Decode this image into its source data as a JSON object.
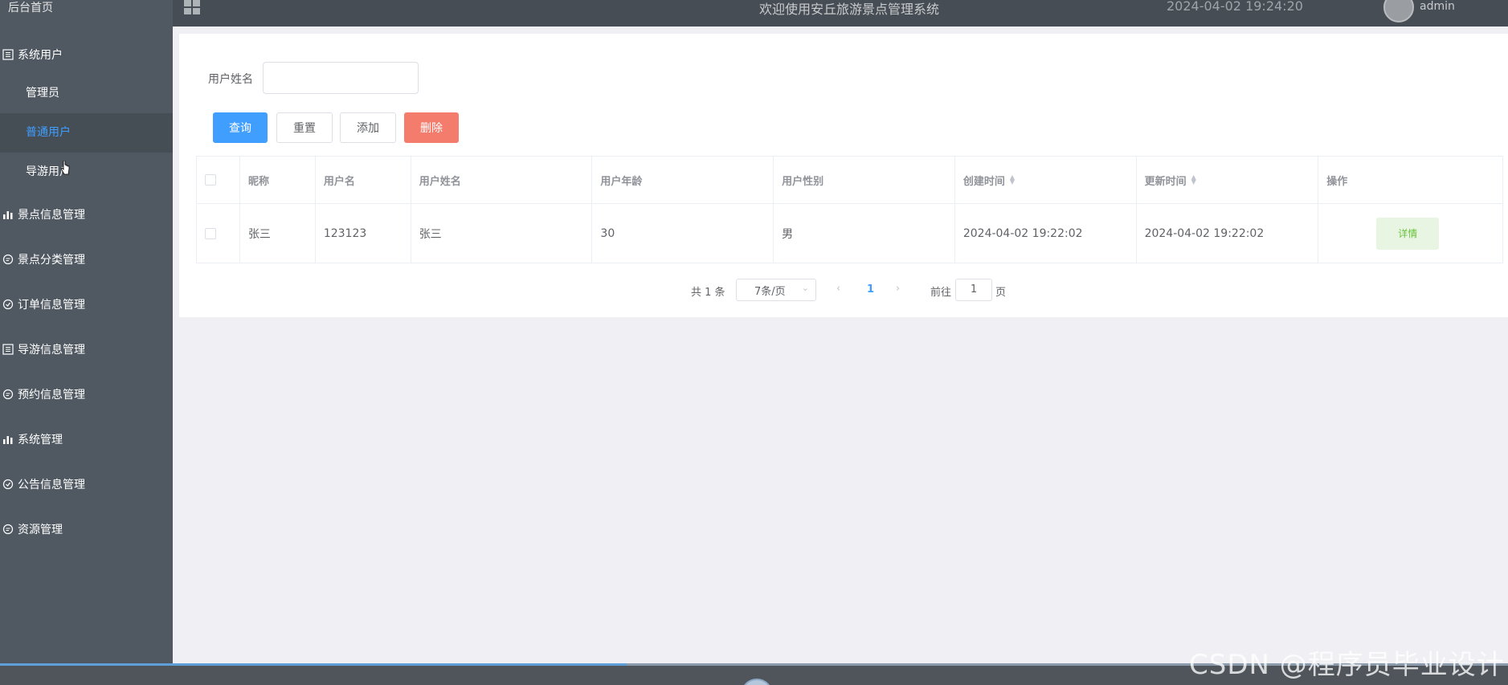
{
  "sidebar": {
    "home": "后台首页",
    "groups": [
      {
        "label": "系统用户",
        "icon": "list-icon"
      },
      {
        "label": "景点信息管理",
        "icon": "bar-chart-icon"
      },
      {
        "label": "景点分类管理",
        "icon": "chat-icon"
      },
      {
        "label": "订单信息管理",
        "icon": "check-circle-icon"
      },
      {
        "label": "导游信息管理",
        "icon": "list-icon"
      },
      {
        "label": "预约信息管理",
        "icon": "chat-icon"
      },
      {
        "label": "系统管理",
        "icon": "bar-chart-icon"
      },
      {
        "label": "公告信息管理",
        "icon": "check-circle-icon"
      },
      {
        "label": "资源管理",
        "icon": "chat-icon"
      }
    ],
    "sub_items": [
      "管理员",
      "普通用户",
      "导游用户"
    ]
  },
  "header": {
    "title": "欢迎使用安丘旅游景点管理系统",
    "time": "2024-04-02 19:24:20",
    "user": "admin"
  },
  "search": {
    "label": "用户姓名",
    "value": ""
  },
  "buttons": {
    "query": "查询",
    "reset": "重置",
    "add": "添加",
    "delete": "删除"
  },
  "table": {
    "headers": [
      "",
      "昵称",
      "用户名",
      "用户姓名",
      "用户年龄",
      "用户性别",
      "创建时间",
      "更新时间",
      "操作"
    ],
    "rows": [
      {
        "nickname": "张三",
        "username": "123123",
        "realname": "张三",
        "age": "30",
        "gender": "男",
        "created": "2024-04-02 19:22:02",
        "updated": "2024-04-02 19:22:02",
        "action": "详情"
      }
    ]
  },
  "pagination": {
    "total": "共 1 条",
    "page_size": "7条/页",
    "current_page": "1",
    "goto_label": "前往",
    "goto_value": "1",
    "page_unit": "页"
  },
  "watermark": "CSDN @程序员毕业设计",
  "colors": {
    "sidebar_bg": "#505962",
    "active": "#409eff",
    "danger": "#f37c6d",
    "success": "#67c23a"
  }
}
